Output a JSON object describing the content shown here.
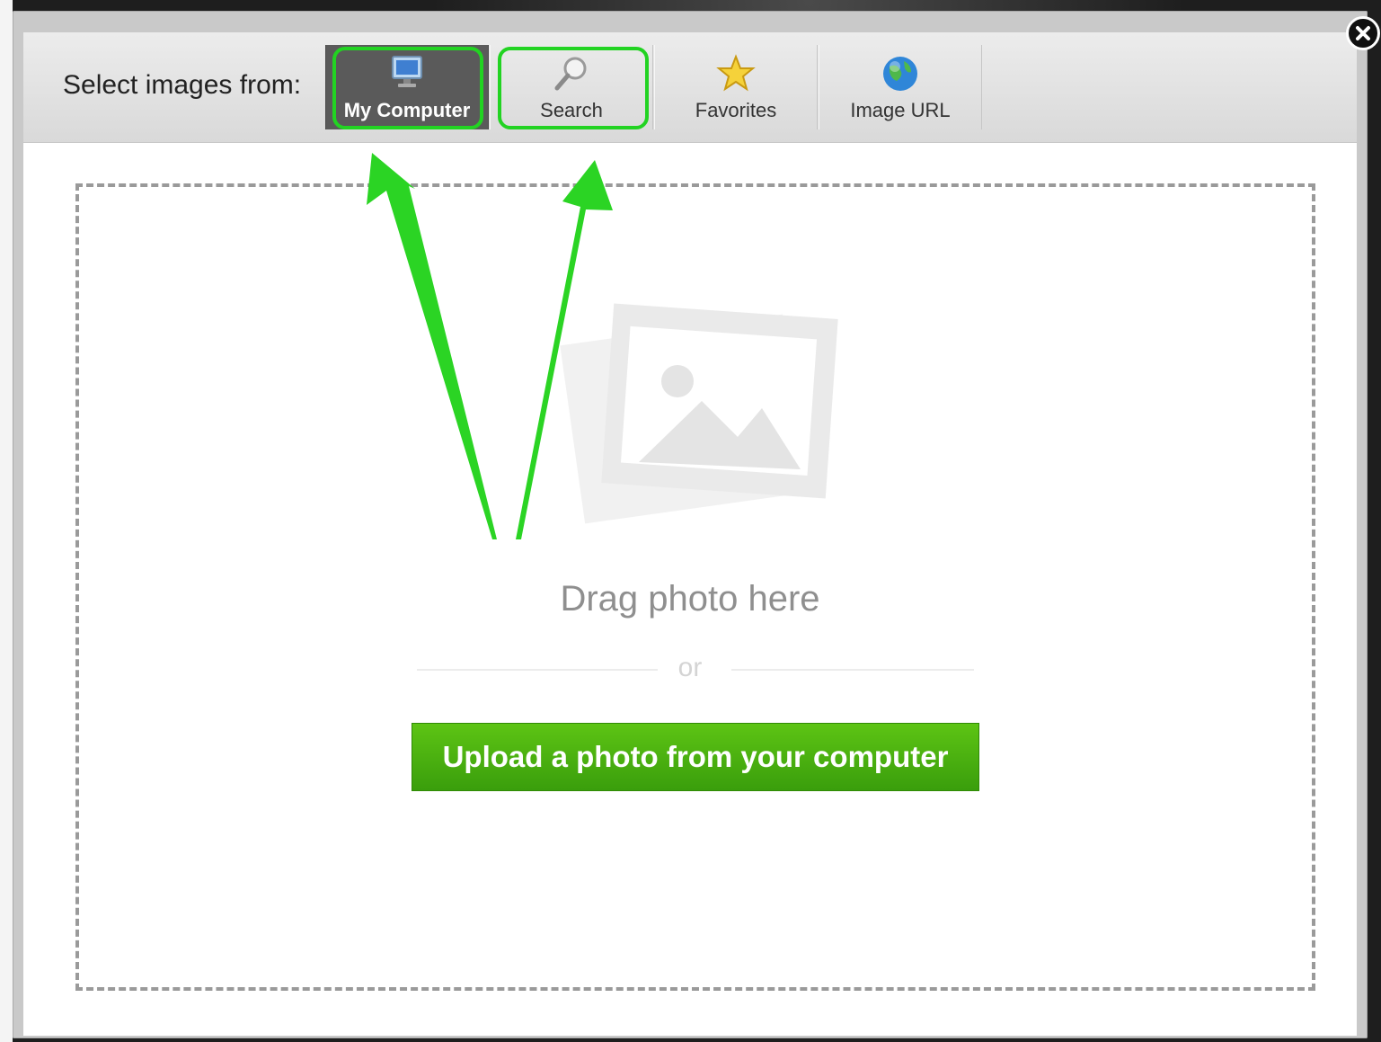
{
  "dialog": {
    "label": "Select images from:",
    "tabs": [
      {
        "label": "My Computer",
        "icon": "monitor-icon",
        "active": true
      },
      {
        "label": "Search",
        "icon": "magnifier-icon",
        "active": false
      },
      {
        "label": "Favorites",
        "icon": "star-icon",
        "active": false
      },
      {
        "label": "Image URL",
        "icon": "globe-icon",
        "active": false
      }
    ],
    "close_icon": "close-icon"
  },
  "dropzone": {
    "drag_text": "Drag photo here",
    "or_text": "or",
    "upload_label": "Upload a photo from your computer",
    "placeholder_icon": "photo-placeholder-icon"
  },
  "colors": {
    "accent_green": "#3fa90e",
    "highlight_green": "#22d322",
    "active_tab": "#5a5a5a"
  }
}
